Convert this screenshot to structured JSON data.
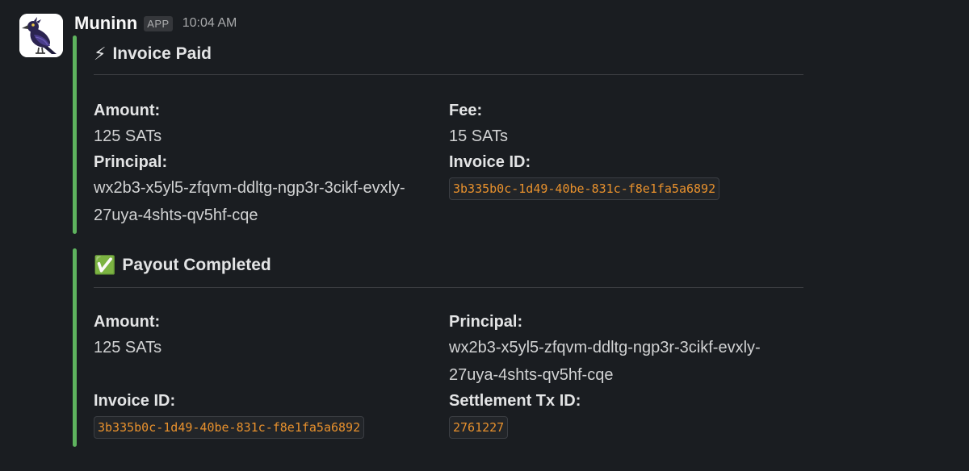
{
  "message": {
    "sender": "Muninn",
    "badge": "APP",
    "time": "10:04 AM",
    "avatar_icon": "raven-icon"
  },
  "attachments": [
    {
      "title": "Invoice Paid",
      "emoji": "⚡",
      "bar_color": "#5eb35e",
      "fields": {
        "amount": {
          "label": "Amount:",
          "value": "125 SATs"
        },
        "fee": {
          "label": "Fee:",
          "value": "15 SATs"
        },
        "principal": {
          "label": "Principal:",
          "value": "wx2b3-x5yl5-zfqvm-ddltg-ngp3r-3cikf-evxly-27uya-4shts-qv5hf-cqe"
        },
        "invoice_id": {
          "label": "Invoice ID:",
          "value": "3b335b0c-1d49-40be-831c-f8e1fa5a6892"
        }
      }
    },
    {
      "title": "Payout Completed",
      "emoji": "✅",
      "bar_color": "#5eb35e",
      "fields": {
        "amount": {
          "label": "Amount:",
          "value": "125 SATs"
        },
        "principal": {
          "label": "Principal:",
          "value": "wx2b3-x5yl5-zfqvm-ddltg-ngp3r-3cikf-evxly-27uya-4shts-qv5hf-cqe"
        },
        "invoice_id": {
          "label": "Invoice ID:",
          "value": "3b335b0c-1d49-40be-831c-f8e1fa5a6892"
        },
        "settlement_tx_id": {
          "label": "Settlement Tx ID:",
          "value": "2761227"
        }
      }
    }
  ],
  "colors": {
    "background": "#1a1d21",
    "accent_bar": "#5eb35e",
    "code_text": "#e8912d"
  }
}
